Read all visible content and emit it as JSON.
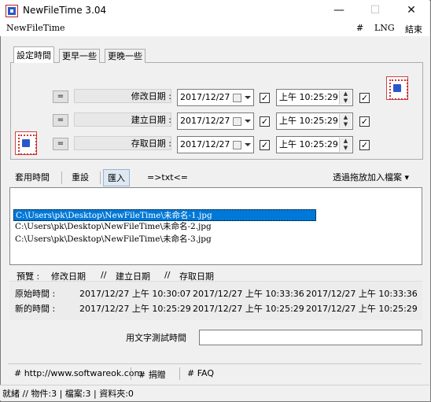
{
  "window": {
    "title": "NewFileTime 3.04"
  },
  "menubar": {
    "left": "NewFileTime",
    "hash": "#",
    "lng": "LNG",
    "exit": "結束"
  },
  "tabs": [
    "設定時間",
    "更早一些",
    "更晚一些"
  ],
  "rows": [
    {
      "eq": "=",
      "label": "修改日期 :",
      "date": "2017/12/27",
      "time": "上午 10:25:29"
    },
    {
      "eq": "=",
      "label": "建立日期 :",
      "date": "2017/12/27",
      "time": "上午 10:25:29"
    },
    {
      "eq": "=",
      "label": "存取日期 :",
      "date": "2017/12/27",
      "time": "上午 10:25:29"
    }
  ],
  "checkboxes": {
    "checked": true,
    "mark": "✓"
  },
  "toolbar": {
    "apply": "套用時間",
    "reset": "重設",
    "import": "匯入",
    "txt": "=>txt<=",
    "dragdrop": "透過拖放加入檔案 ▾"
  },
  "files": [
    "C:\\Users\\pk\\Desktop\\NewFileTime\\未命名-1.jpg",
    "C:\\Users\\pk\\Desktop\\NewFileTime\\未命名-2.jpg",
    "C:\\Users\\pk\\Desktop\\NewFileTime\\未命名-3.jpg"
  ],
  "preview": {
    "label": "預覽 :",
    "h_modify": "修改日期",
    "sep": "//",
    "h_create": "建立日期",
    "h_access": "存取日期",
    "orig_label": "原始時間 :",
    "orig": [
      "2017/12/27 上午 10:30:07",
      "2017/12/27 上午 10:33:36",
      "2017/12/27 上午 10:33:36"
    ],
    "new_label": "新的時間 :",
    "new": [
      "2017/12/27 上午 10:25:29",
      "2017/12/27 上午 10:25:29",
      "2017/12/27 上午 10:25:29"
    ]
  },
  "test": {
    "label": "用文字測試時間",
    "value": ""
  },
  "links": [
    "# http://www.softwareok.com",
    "# 捐贈",
    "# FAQ"
  ],
  "status": "就緒 // 物件:3  | 檔案:3  | 資料夾:0",
  "colors": {
    "selection": "#0078d7",
    "window_bg": "#f0f0f0"
  }
}
